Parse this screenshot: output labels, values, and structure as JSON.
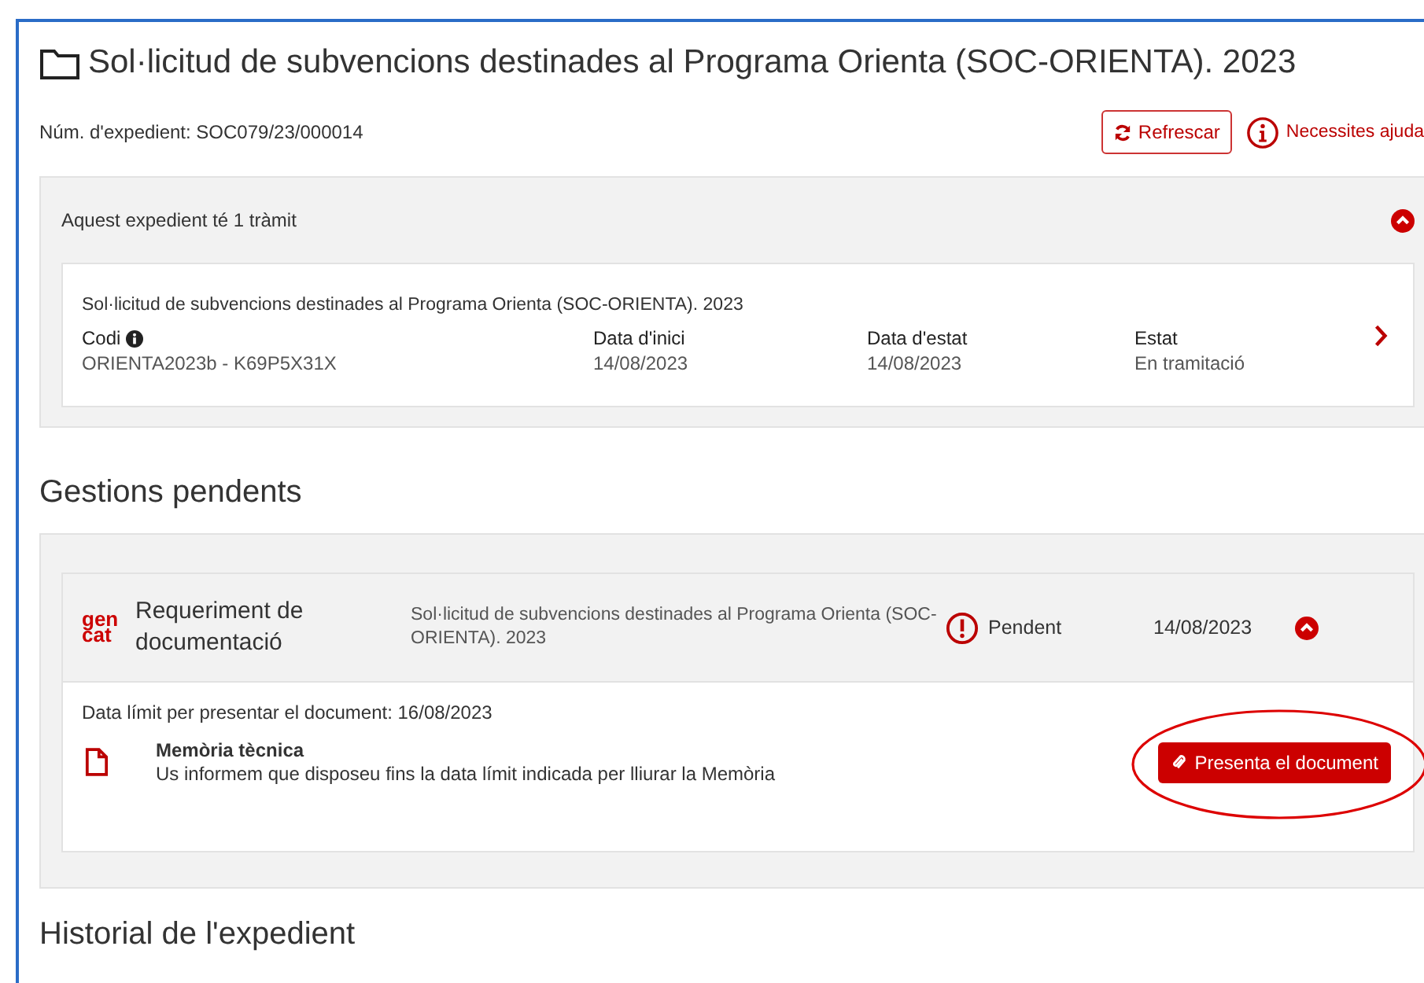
{
  "title": "Sol·licitud de subvencions destinades al Programa Orienta (SOC-ORIENTA). 2023",
  "file_number": "Núm. d'expedient: SOC079/23/000014",
  "actions": {
    "refresh": "Refrescar",
    "help": "Necessites ajuda"
  },
  "procedures_panel": {
    "heading": "Aquest expedient té 1 tràmit",
    "expanded": true,
    "procedures": [
      {
        "title": "Sol·licitud de subvencions destinades al Programa Orienta (SOC-ORIENTA). 2023",
        "fields": [
          {
            "label": "Codi",
            "value": "ORIENTA2023b - K69P5X31X",
            "info": true
          },
          {
            "label": "Data d'inici",
            "value": "14/08/2023",
            "info": false
          },
          {
            "label": "Data d'estat",
            "value": "14/08/2023",
            "info": false
          },
          {
            "label": "Estat",
            "value": "En tramitació",
            "info": false
          }
        ]
      }
    ]
  },
  "pending_heading": "Gestions pendents",
  "pending": [
    {
      "logo": [
        "gen",
        "cat"
      ],
      "name": "Requeriment de documentació",
      "procedure": "Sol·licitud de subvencions destinades al Programa Orienta (SOC-ORIENTA). 2023",
      "status": "Pendent",
      "date": "14/08/2023",
      "expanded": true,
      "deadline": "Data límit per presentar el document: 16/08/2023",
      "document": {
        "title": "Memòria tècnica",
        "description": "Us informem que disposeu fins la data límit indicada per lliurar la Memòria"
      },
      "button": "Presenta el document",
      "highlighted": true
    }
  ],
  "history_heading": "Historial de l'expedient"
}
